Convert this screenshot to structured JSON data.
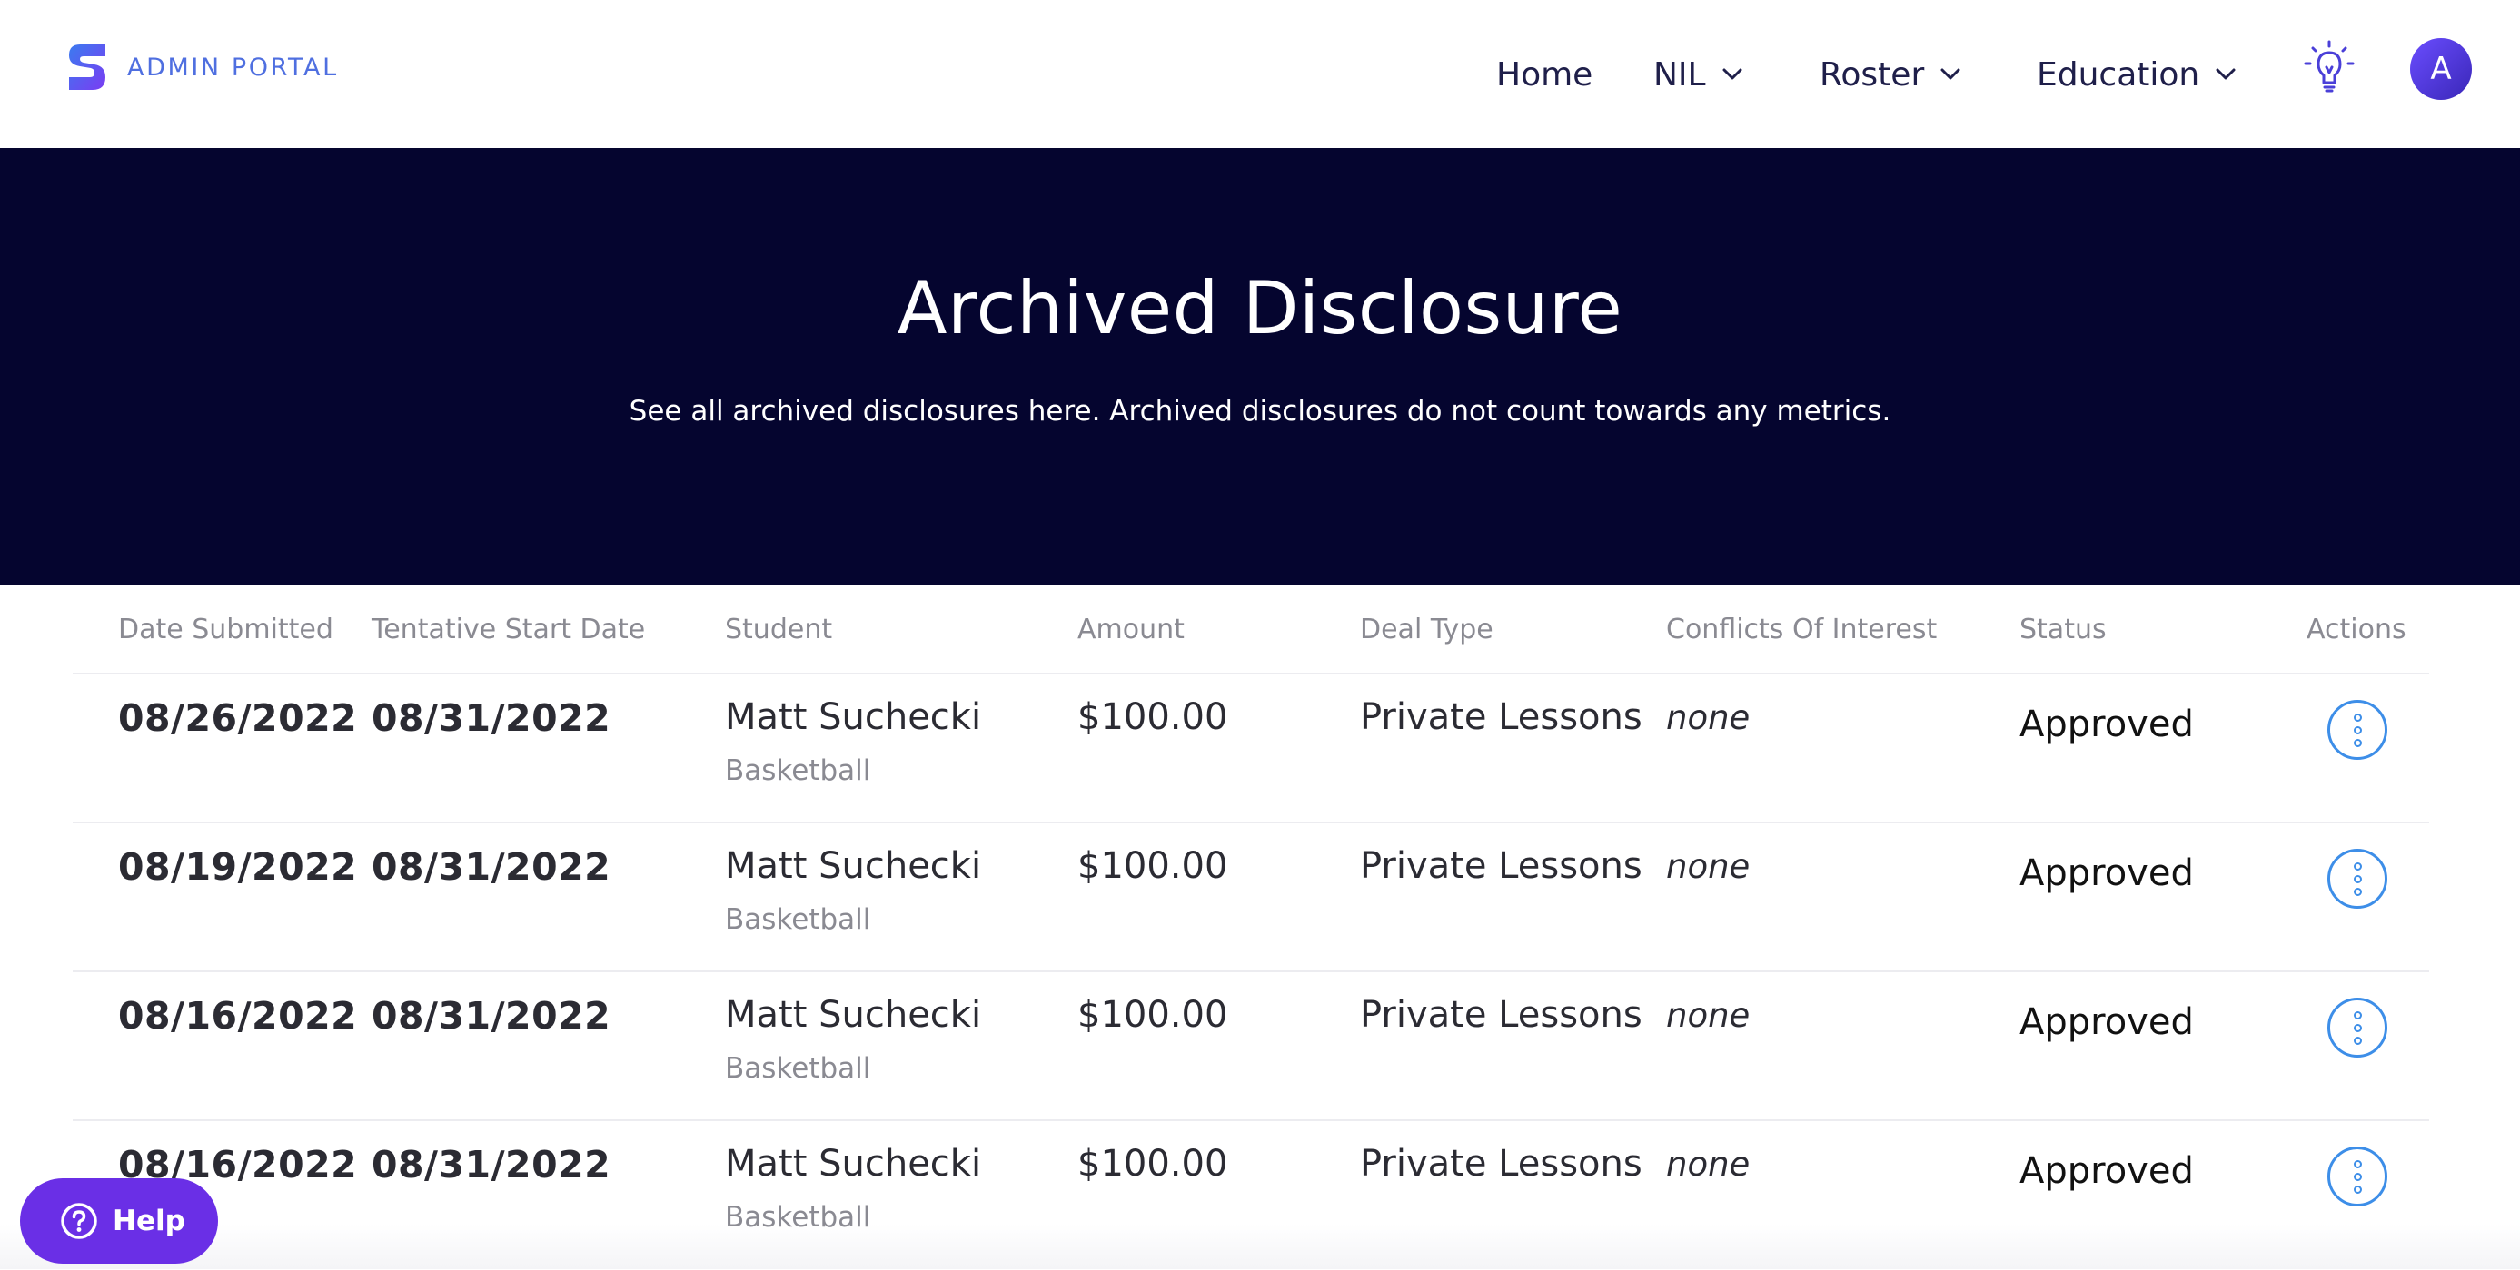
{
  "header": {
    "brand": "ADMIN PORTAL",
    "nav": [
      {
        "label": "Home",
        "has_dropdown": false
      },
      {
        "label": "NIL",
        "has_dropdown": true
      },
      {
        "label": "Roster",
        "has_dropdown": true
      },
      {
        "label": "Education",
        "has_dropdown": true
      }
    ],
    "tips_icon": "lightbulb-icon",
    "avatar_initial": "A"
  },
  "hero": {
    "title": "Archived Disclosure",
    "subtitle": "See all archived disclosures here. Archived disclosures do not count towards any metrics."
  },
  "table": {
    "columns": [
      "Date Submitted",
      "Tentative Start Date",
      "Student",
      "Amount",
      "Deal Type",
      "Conflicts Of Interest",
      "Status",
      "Actions"
    ],
    "rows": [
      {
        "date_submitted": "08/26/2022",
        "start_date": "08/31/2022",
        "student": "Matt Suchecki",
        "sport": "Basketball",
        "amount": "$100.00",
        "deal_type": "Private Lessons",
        "conflicts": "none",
        "status": "Approved"
      },
      {
        "date_submitted": "08/19/2022",
        "start_date": "08/31/2022",
        "student": "Matt Suchecki",
        "sport": "Basketball",
        "amount": "$100.00",
        "deal_type": "Private Lessons",
        "conflicts": "none",
        "status": "Approved"
      },
      {
        "date_submitted": "08/16/2022",
        "start_date": "08/31/2022",
        "student": "Matt Suchecki",
        "sport": "Basketball",
        "amount": "$100.00",
        "deal_type": "Private Lessons",
        "conflicts": "none",
        "status": "Approved"
      },
      {
        "date_submitted": "08/16/2022",
        "start_date": "08/31/2022",
        "student": "Matt Suchecki",
        "sport": "Basketball",
        "amount": "$100.00",
        "deal_type": "Private Lessons",
        "conflicts": "none",
        "status": "Approved"
      }
    ]
  },
  "help": {
    "label": "Help"
  },
  "colors": {
    "hero_bg": "#05052f",
    "accent_purple": "#6a2fe6",
    "action_blue": "#3d8ee8",
    "brand_blue": "#4f6fe0",
    "nav_text": "#1f1f4a"
  }
}
